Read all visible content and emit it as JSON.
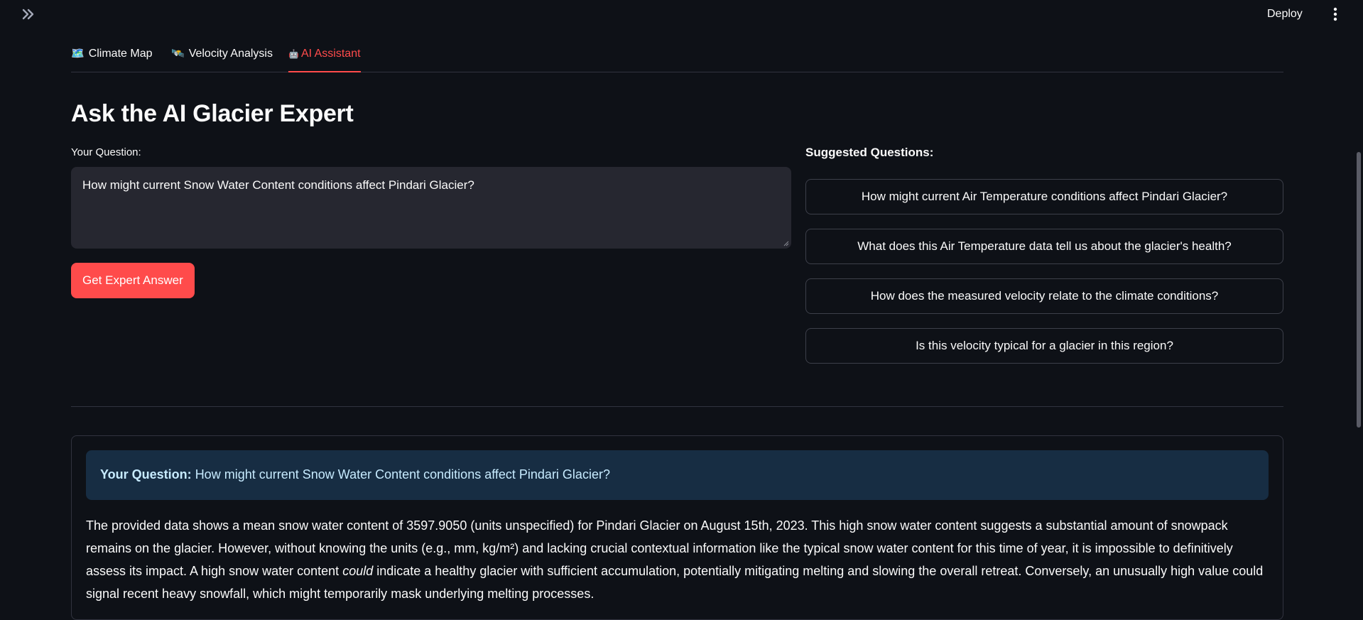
{
  "header": {
    "deploy_label": "Deploy"
  },
  "tabs": [
    {
      "icon": "🗺️",
      "label": "Climate Map"
    },
    {
      "icon": "🛰️",
      "label": "Velocity Analysis"
    },
    {
      "icon": "🤖",
      "label": "AI Assistant"
    }
  ],
  "active_tab": "AI Assistant",
  "main": {
    "title": "Ask the AI Glacier Expert",
    "question_label": "Your Question:",
    "question_value": "How might current Snow Water Content conditions affect Pindari Glacier?",
    "submit_label": "Get Expert Answer"
  },
  "suggestions": {
    "heading": "Suggested Questions:",
    "items": [
      "How might current Air Temperature conditions affect Pindari Glacier?",
      "What does this Air Temperature data tell us about the glacier's health?",
      "How does the measured velocity relate to the climate conditions?",
      "Is this velocity typical for a glacier in this region?"
    ]
  },
  "answer": {
    "question_prefix": "Your Question:",
    "question_text": "How might current Snow Water Content conditions affect Pindari Glacier?",
    "body_part1": "The provided data shows a mean snow water content of 3597.9050 (units unspecified) for Pindari Glacier on August 15th, 2023. This high snow water content suggests a substantial amount of snowpack remains on the glacier. However, without knowing the units (e.g., mm, kg/m²) and lacking crucial contextual information like the typical snow water content for this time of year, it is impossible to definitively assess its impact. A high snow water content ",
    "body_emphasis": "could",
    "body_part2": " indicate a healthy glacier with sufficient accumulation, potentially mitigating melting and slowing the overall retreat. Conversely, an unusually high value could signal recent heavy snowfall, which might temporarily mask underlying melting processes."
  },
  "colors": {
    "background": "#0e1117",
    "accent": "#ff4b4b",
    "info_bg": "#172d43",
    "info_text": "#c7ebff"
  },
  "icons": {
    "sidebar_toggle": "double-chevron-right-icon",
    "more_menu": "vertical-dots-icon"
  }
}
